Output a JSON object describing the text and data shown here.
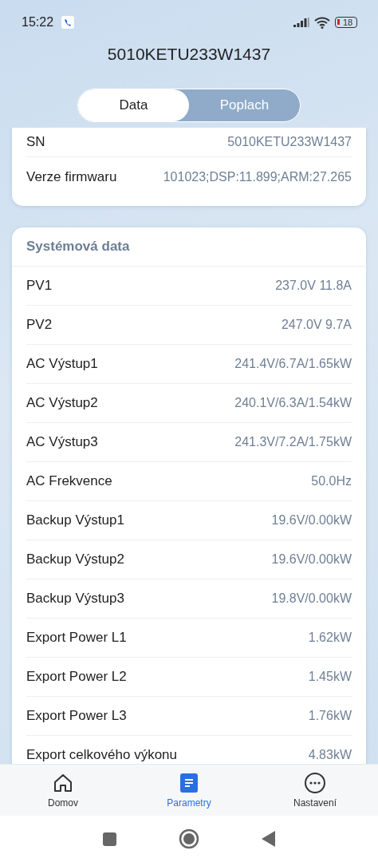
{
  "status_bar": {
    "time": "15:22",
    "battery": "18"
  },
  "title": "5010KETU233W1437",
  "tabs": [
    {
      "label": "Data",
      "selected": true
    },
    {
      "label": "Poplach",
      "selected": false
    }
  ],
  "device_card": {
    "rows": [
      {
        "label": "SN",
        "value": "5010KETU233W1437"
      },
      {
        "label": "Verze firmwaru",
        "value": "101023;DSP:11.899;ARM:27.265"
      }
    ]
  },
  "system_card": {
    "title": "Systémová data",
    "rows": [
      {
        "label": "PV1",
        "value": "237.0V 11.8A"
      },
      {
        "label": "PV2",
        "value": "247.0V 9.7A"
      },
      {
        "label": "AC Výstup1",
        "value": "241.4V/6.7A/1.65kW"
      },
      {
        "label": "AC Výstup2",
        "value": "240.1V/6.3A/1.54kW"
      },
      {
        "label": "AC Výstup3",
        "value": "241.3V/7.2A/1.75kW"
      },
      {
        "label": "AC Frekvence",
        "value": "50.0Hz"
      },
      {
        "label": "Backup Výstup1",
        "value": "19.6V/0.00kW"
      },
      {
        "label": "Backup Výstup2",
        "value": "19.6V/0.00kW"
      },
      {
        "label": "Backup Výstup3",
        "value": "19.8V/0.00kW"
      },
      {
        "label": "Export Power  L1",
        "value": "1.62kW"
      },
      {
        "label": "Export Power  L2",
        "value": "1.45kW"
      },
      {
        "label": "Export Power  L3",
        "value": "1.76kW"
      },
      {
        "label": "Export celkového výkonu",
        "value": "4.83kW"
      }
    ]
  },
  "bottom_nav": [
    {
      "label": "Domov",
      "kind": "home",
      "selected": false
    },
    {
      "label": "Parametry",
      "kind": "params",
      "selected": true
    },
    {
      "label": "Nastavení",
      "kind": "more",
      "selected": false
    }
  ]
}
